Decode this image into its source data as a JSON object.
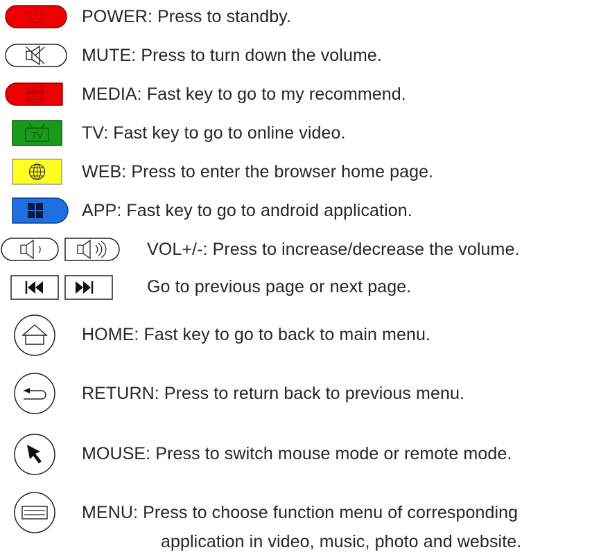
{
  "legend": {
    "power": {
      "icon": "power-icon",
      "text": "POWER: Press to standby.",
      "color": "#ee0000"
    },
    "mute": {
      "icon": "mute-speaker-icon",
      "text": "MUTE: Press to turn down the volume."
    },
    "media": {
      "icon": "clapperboard-icon",
      "text": "MEDIA: Fast key to go to my recommend.",
      "color": "#ee0000"
    },
    "tv": {
      "icon": "tv-icon",
      "icon_label": "TV",
      "text": "TV: Fast key to go to online video.",
      "color": "#1a9a1a"
    },
    "web": {
      "icon": "globe-icon",
      "text": "WEB: Press to enter the browser home page.",
      "color": "#ffff22"
    },
    "app": {
      "icon": "app-grid-icon",
      "text": "APP: Fast key to go to android application.",
      "color": "#1e6fe0"
    },
    "vol": {
      "icons": [
        "volume-down-icon",
        "volume-up-icon"
      ],
      "text": "VOL+/-: Press to increase/decrease the volume."
    },
    "page": {
      "icons": [
        "previous-page-icon",
        "next-page-icon"
      ],
      "text": "Go to previous page or next page."
    },
    "home": {
      "icon": "home-icon",
      "text": "HOME: Fast key to go to back to main menu."
    },
    "return": {
      "icon": "return-arrow-icon",
      "text": "RETURN: Press to return back to previous menu."
    },
    "mouse": {
      "icon": "mouse-pointer-icon",
      "text": "MOUSE: Press to switch mouse mode or remote mode."
    },
    "menu": {
      "icon": "menu-icon",
      "text_line1": "MENU: Press to choose function menu of corresponding",
      "text_line2": "application in video, music, photo and website."
    }
  }
}
